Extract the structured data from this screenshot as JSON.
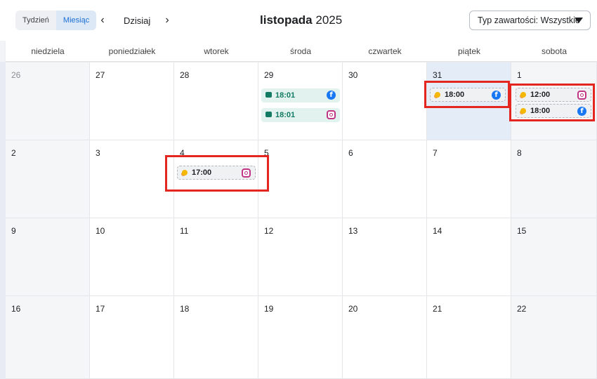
{
  "toolbar": {
    "view_week": "Tydzień",
    "view_month": "Miesiąc",
    "prev_icon": "chevron-left-icon",
    "next_icon": "chevron-right-icon",
    "today_label": "Dzisiaj",
    "month_name": "listopada",
    "year": "2025",
    "content_type_label": "Typ zawartości: Wszystkie",
    "accent_color": "#1b6fd3"
  },
  "weekdays": [
    "niedziela",
    "poniedziałek",
    "wtorek",
    "środa",
    "czwartek",
    "piątek",
    "sobota"
  ],
  "weeks": [
    [
      "26",
      "27",
      "28",
      "29",
      "30",
      "31",
      "1"
    ],
    [
      "2",
      "3",
      "4",
      "5",
      "6",
      "7",
      "8"
    ],
    [
      "9",
      "10",
      "11",
      "12",
      "13",
      "14",
      "15"
    ],
    [
      "16",
      "17",
      "18",
      "19",
      "20",
      "21",
      "22"
    ]
  ],
  "events": {
    "wed29_fb": {
      "time": "18:01",
      "status": "published",
      "platform": "facebook"
    },
    "wed29_ig": {
      "time": "18:01",
      "status": "published",
      "platform": "instagram"
    },
    "fri31_fb": {
      "time": "18:00",
      "status": "scheduled",
      "platform": "facebook"
    },
    "sat1_ig": {
      "time": "12:00",
      "status": "scheduled",
      "platform": "instagram"
    },
    "sat1_fb": {
      "time": "18:00",
      "status": "scheduled",
      "platform": "facebook"
    },
    "tue4_ig": {
      "time": "17:00",
      "status": "scheduled",
      "platform": "instagram"
    }
  },
  "colors": {
    "published_bg": "#e2f2ee",
    "published_text": "#137a63",
    "today_bg": "#e3ecf7",
    "highlight": "#e3261f",
    "facebook": "#1877f2",
    "instagram": "#c13584"
  }
}
